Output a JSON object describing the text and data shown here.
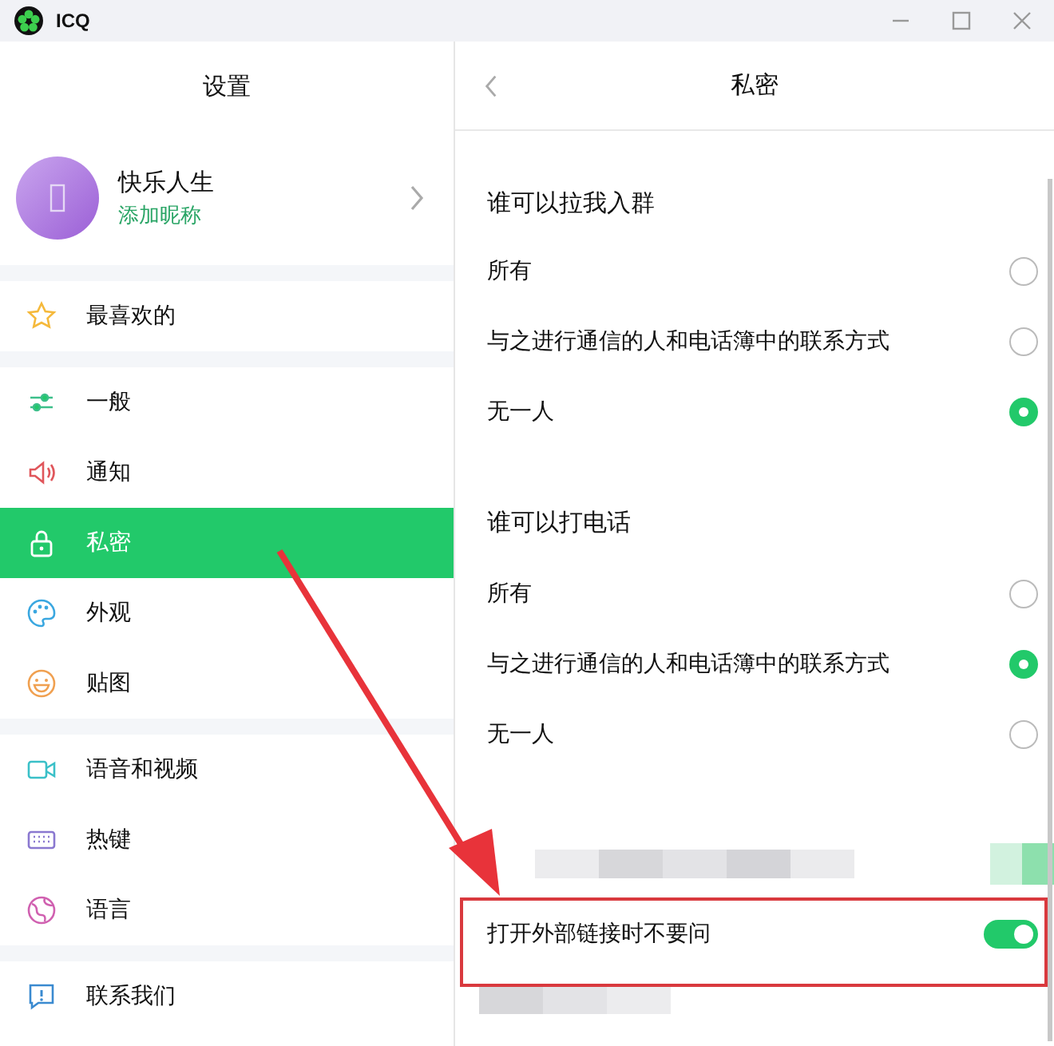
{
  "window": {
    "title": "ICQ"
  },
  "sidebar": {
    "title": "设置",
    "profile": {
      "name": "快乐人生",
      "subtitle": "添加昵称"
    },
    "groups": [
      [
        {
          "label": "最喜欢的",
          "selected": false
        }
      ],
      [
        {
          "label": "一般",
          "selected": false
        },
        {
          "label": "通知",
          "selected": false
        },
        {
          "label": "私密",
          "selected": true
        },
        {
          "label": "外观",
          "selected": false
        },
        {
          "label": "贴图",
          "selected": false
        }
      ],
      [
        {
          "label": "语音和视频",
          "selected": false
        },
        {
          "label": "热键",
          "selected": false
        },
        {
          "label": "语言",
          "selected": false
        }
      ],
      [
        {
          "label": "联系我们",
          "selected": false
        }
      ]
    ]
  },
  "panel": {
    "title": "私密",
    "sections": [
      {
        "title": "谁可以拉我入群",
        "options": [
          {
            "label": "所有",
            "selected": false
          },
          {
            "label": "与之进行通信的人和电话簿中的联系方式",
            "selected": false
          },
          {
            "label": "无一人",
            "selected": true
          }
        ]
      },
      {
        "title": "谁可以打电话",
        "options": [
          {
            "label": "所有",
            "selected": false
          },
          {
            "label": "与之进行通信的人和电话簿中的联系方式",
            "selected": true
          },
          {
            "label": "无一人",
            "selected": false
          }
        ]
      }
    ],
    "toggle": {
      "label": "打开外部链接时不要问",
      "on": true
    }
  }
}
